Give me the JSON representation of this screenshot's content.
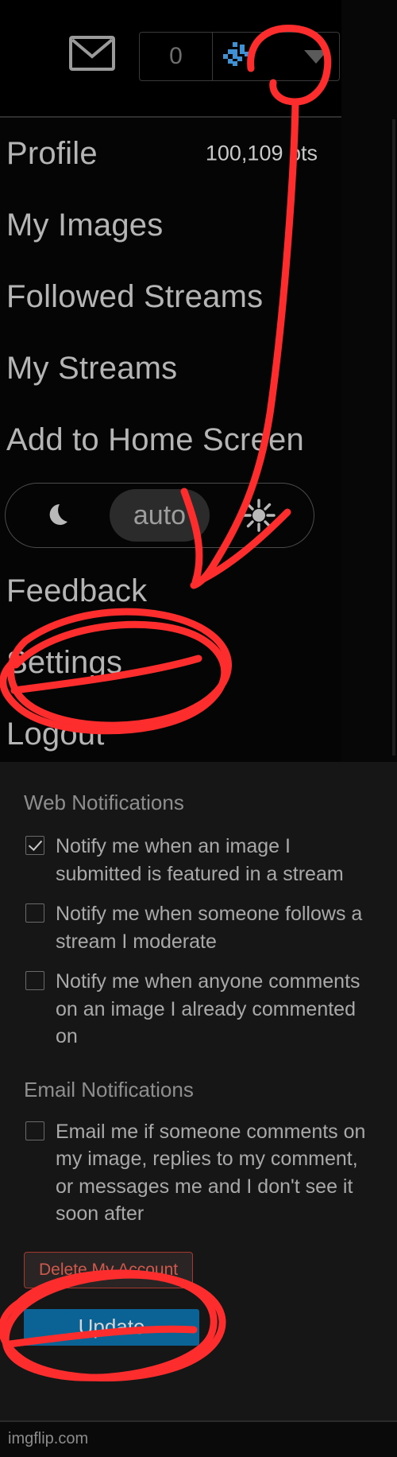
{
  "topbar": {
    "mail_icon": "envelope-icon",
    "message_count": "0",
    "brand_icon": "imgflip-logo-icon",
    "caret_icon": "chevron-down-icon"
  },
  "menu": {
    "items": [
      {
        "label": "Profile",
        "meta": "100,109 pts"
      },
      {
        "label": "My Images",
        "meta": ""
      },
      {
        "label": "Followed Streams",
        "meta": ""
      },
      {
        "label": "My Streams",
        "meta": ""
      },
      {
        "label": "Add to Home Screen",
        "meta": ""
      }
    ],
    "theme": {
      "dark_icon": "moon-icon",
      "auto_label": "auto",
      "light_icon": "sun-icon",
      "selected": "auto"
    },
    "items_after": [
      {
        "label": "Feedback"
      },
      {
        "label": "Settings"
      },
      {
        "label": "Logout"
      }
    ]
  },
  "settings": {
    "web_section_title": "Web Notifications",
    "web_options": [
      {
        "label": "Notify me when an image I submitted is featured in a stream",
        "checked": true
      },
      {
        "label": "Notify me when someone follows a stream I moderate",
        "checked": false
      },
      {
        "label": "Notify me when anyone comments on an image I already commented on",
        "checked": false
      }
    ],
    "email_section_title": "Email Notifications",
    "email_options": [
      {
        "label": "Email me if someone comments on my image, replies to my comment, or messages me and I don't see it soon after",
        "checked": false
      }
    ],
    "delete_label": "Delete My Account",
    "update_label": "Update"
  },
  "watermark": "imgflip.com",
  "colors": {
    "accent_blue": "#0a6394",
    "danger_red": "#cd5a4d",
    "annotation_red": "#fd2d2d",
    "panel_bg": "#161616",
    "menu_bg": "#050505"
  }
}
